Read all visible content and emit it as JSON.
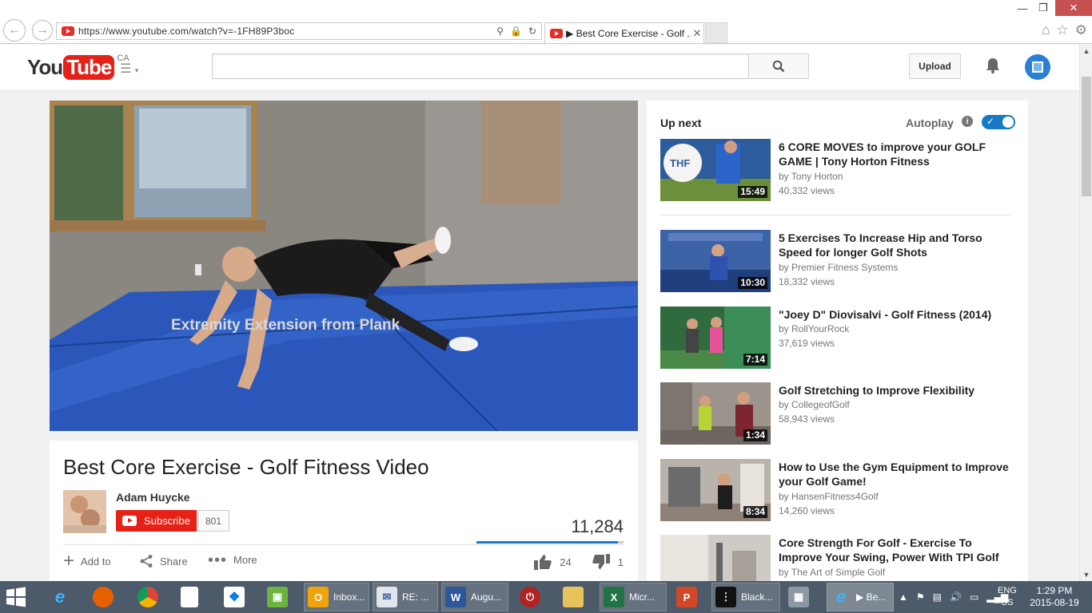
{
  "browser": {
    "url": "https://www.youtube.com/watch?v=-1FH89P3boc",
    "tab_title": "▶ Best Core Exercise - Golf ...",
    "tab_close": "✕"
  },
  "masthead": {
    "logo_you": "You",
    "logo_tube": "Tube",
    "country": "CA",
    "upload_label": "Upload"
  },
  "player": {
    "overlay_text": "Extremity Extension from Plank"
  },
  "video": {
    "title": "Best Core Exercise - Golf Fitness Video",
    "channel": "Adam Huycke",
    "subscribe_label": "Subscribe",
    "subscriber_count": "801",
    "view_count": "11,284",
    "like_ratio": 0.96,
    "add_to_label": "Add to",
    "share_label": "Share",
    "more_label": "More",
    "likes": "24",
    "dislikes": "1"
  },
  "sidebar": {
    "up_next_label": "Up next",
    "autoplay_label": "Autoplay",
    "autoplay_on": true,
    "videos": [
      {
        "title": "6 CORE MOVES to improve your GOLF GAME | Tony Horton Fitness",
        "by": "by Tony Horton",
        "views": "40,332 views",
        "duration": "15:49"
      },
      {
        "title": "5 Exercises To Increase Hip and Torso Speed for longer Golf Shots",
        "by": "by Premier Fitness Systems",
        "views": "18,332 views",
        "duration": "10:30"
      },
      {
        "title": "\"Joey D\" Diovisalvi - Golf Fitness (2014)",
        "by": "by RollYourRock",
        "views": "37,619 views",
        "duration": "7:14"
      },
      {
        "title": "Golf Stretching to Improve Flexibility",
        "by": "by CollegeofGolf",
        "views": "58,943 views",
        "duration": "1:34"
      },
      {
        "title": "How to Use the Gym Equipment to Improve your Golf Game!",
        "by": "by HansenFitness4Golf",
        "views": "14,260 views",
        "duration": "8:34"
      },
      {
        "title": "Core Strength For Golf - Exercise To Improve Your Swing, Power With TPI Golf",
        "by": "by The Art of Simple Golf",
        "views": "",
        "duration": ""
      }
    ]
  },
  "taskbar": {
    "items": [
      {
        "label": "Inbox..."
      },
      {
        "label": "RE: ..."
      },
      {
        "label": "Augu..."
      },
      {
        "label": "Micr..."
      },
      {
        "label": "Black..."
      },
      {
        "label": "▶ Be..."
      }
    ],
    "lang_1": "ENG",
    "lang_2": "US",
    "time": "1:29 PM",
    "date": "2015-08-19"
  }
}
